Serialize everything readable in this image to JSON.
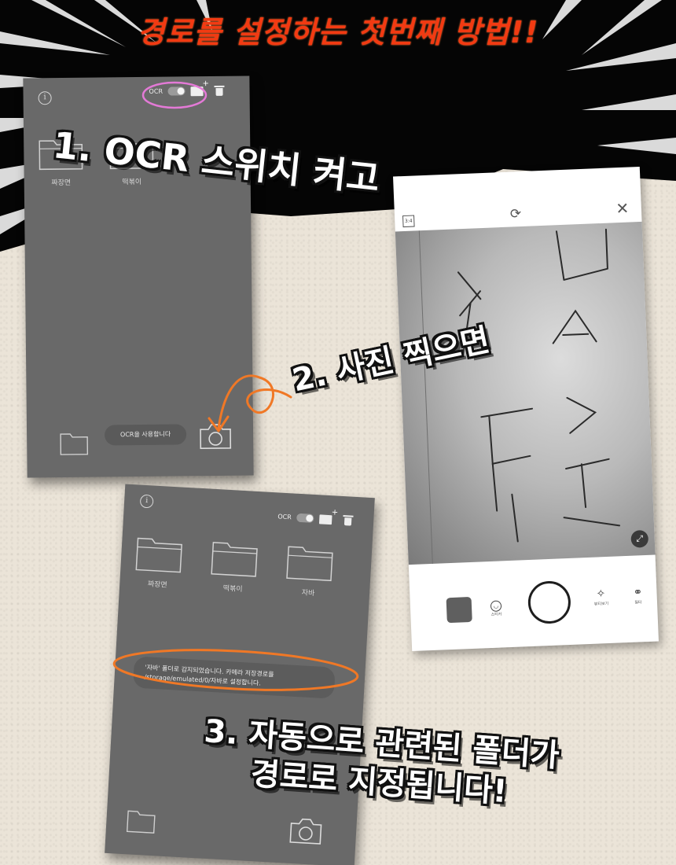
{
  "headline": "경로를 설정하는 첫번째 방법!!",
  "step1_caption": "1. OCR 스위치 켜고",
  "step2_caption": "2. 사진 찍으면",
  "step3_caption_line1": "3. 자동으로 관련된 폴더가",
  "step3_caption_line2": "경로로 지정됩니다!",
  "screen1": {
    "ocr_label": "OCR",
    "folders": [
      {
        "label": "짜장면"
      },
      {
        "label": "떡볶이"
      }
    ],
    "status_pill": "OCR을 사용합니다"
  },
  "screen2": {
    "ocr_label": "OCR",
    "folders": [
      {
        "label": "짜장면"
      },
      {
        "label": "떡볶이"
      },
      {
        "label": "자바"
      }
    ],
    "toast_line1": "'자바' 폴더로 감지되었습니다. 카메라 저장경로를",
    "toast_line2": "/storage/emulated/0/자바로 설정합니다."
  },
  "camera": {
    "ratio_label": "3:4",
    "sticker_label": "스티커",
    "beauty_label": "뷰티보기",
    "filter_label": "필터"
  },
  "colors": {
    "headline": "#f23a12",
    "highlight_ring": "#e37ad6",
    "arrow": "#f07826",
    "panel": "#696969"
  }
}
